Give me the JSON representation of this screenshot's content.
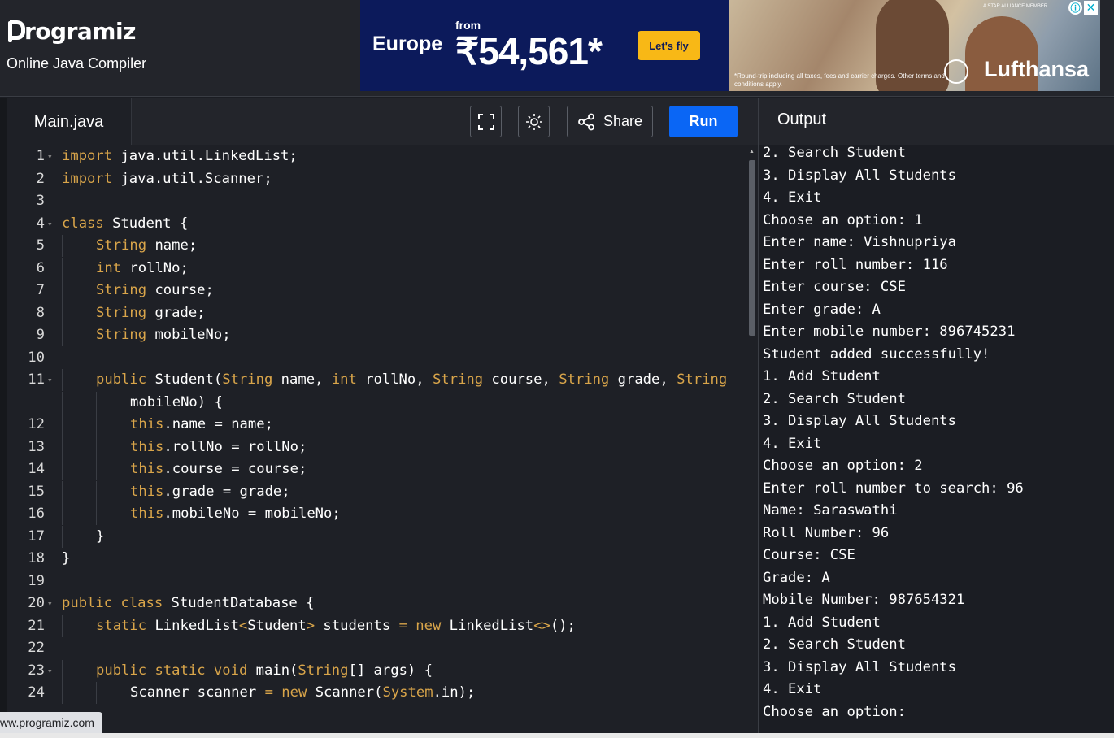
{
  "brand": {
    "name": "rogramiz",
    "subtitle": "Online Java Compiler"
  },
  "ads": {
    "flight": {
      "destination": "Europe",
      "from_label": "from",
      "price": "₹54,561*",
      "cta": "Let's fly"
    },
    "lufthansa": {
      "brand": "Lufthansa",
      "tagline": "A STAR ALLIANCE MEMBER",
      "fine_print": "*Round-trip including all taxes, fees and carrier charges. Other terms and conditions apply.",
      "info_icon": "ⓘ",
      "close_icon": "✕"
    }
  },
  "editor": {
    "tab": "Main.java",
    "buttons": {
      "fullscreen": "fullscreen-icon",
      "theme": "sun-icon",
      "share": "Share",
      "run": "Run"
    },
    "lines": [
      {
        "n": "1",
        "fold": true,
        "segments": [
          [
            "kw",
            "import"
          ],
          [
            "t",
            " java.util.LinkedList;"
          ]
        ]
      },
      {
        "n": "2",
        "fold": false,
        "segments": [
          [
            "kw",
            "import"
          ],
          [
            "t",
            " java.util.Scanner;"
          ]
        ]
      },
      {
        "n": "3",
        "fold": false,
        "segments": []
      },
      {
        "n": "4",
        "fold": true,
        "segments": [
          [
            "kw",
            "class"
          ],
          [
            "t",
            " Student {"
          ]
        ]
      },
      {
        "n": "5",
        "fold": false,
        "indent": 1,
        "segments": [
          [
            "kw",
            "String"
          ],
          [
            "t",
            " name;"
          ]
        ]
      },
      {
        "n": "6",
        "fold": false,
        "indent": 1,
        "segments": [
          [
            "kw",
            "int"
          ],
          [
            "t",
            " rollNo;"
          ]
        ]
      },
      {
        "n": "7",
        "fold": false,
        "indent": 1,
        "segments": [
          [
            "kw",
            "String"
          ],
          [
            "t",
            " course;"
          ]
        ]
      },
      {
        "n": "8",
        "fold": false,
        "indent": 1,
        "segments": [
          [
            "kw",
            "String"
          ],
          [
            "t",
            " grade;"
          ]
        ]
      },
      {
        "n": "9",
        "fold": false,
        "indent": 1,
        "segments": [
          [
            "kw",
            "String"
          ],
          [
            "t",
            " mobileNo;"
          ]
        ]
      },
      {
        "n": "10",
        "fold": false,
        "segments": []
      },
      {
        "n": "11",
        "fold": true,
        "indent": 1,
        "segments": [
          [
            "kw",
            "public"
          ],
          [
            "t",
            " Student("
          ],
          [
            "kw",
            "String"
          ],
          [
            "t",
            " name, "
          ],
          [
            "kw",
            "int"
          ],
          [
            "t",
            " rollNo, "
          ],
          [
            "kw",
            "String"
          ],
          [
            "t",
            " course, "
          ],
          [
            "kw",
            "String"
          ],
          [
            "t",
            " grade, "
          ],
          [
            "kw",
            "String"
          ]
        ]
      },
      {
        "n": "",
        "fold": false,
        "indent": 2,
        "segments": [
          [
            "t",
            "mobileNo) {"
          ]
        ]
      },
      {
        "n": "12",
        "fold": false,
        "indent": 2,
        "segments": [
          [
            "kw",
            "this"
          ],
          [
            "t",
            ".name = name;"
          ]
        ]
      },
      {
        "n": "13",
        "fold": false,
        "indent": 2,
        "segments": [
          [
            "kw",
            "this"
          ],
          [
            "t",
            ".rollNo = rollNo;"
          ]
        ]
      },
      {
        "n": "14",
        "fold": false,
        "indent": 2,
        "segments": [
          [
            "kw",
            "this"
          ],
          [
            "t",
            ".course = course;"
          ]
        ]
      },
      {
        "n": "15",
        "fold": false,
        "indent": 2,
        "segments": [
          [
            "kw",
            "this"
          ],
          [
            "t",
            ".grade = grade;"
          ]
        ]
      },
      {
        "n": "16",
        "fold": false,
        "indent": 2,
        "segments": [
          [
            "kw",
            "this"
          ],
          [
            "t",
            ".mobileNo = mobileNo;"
          ]
        ]
      },
      {
        "n": "17",
        "fold": false,
        "indent": 1,
        "segments": [
          [
            "t",
            "}"
          ]
        ]
      },
      {
        "n": "18",
        "fold": false,
        "segments": [
          [
            "t",
            "}"
          ]
        ]
      },
      {
        "n": "19",
        "fold": false,
        "segments": []
      },
      {
        "n": "20",
        "fold": true,
        "segments": [
          [
            "kw",
            "public"
          ],
          [
            "t",
            " "
          ],
          [
            "kw",
            "class"
          ],
          [
            "t",
            " StudentDatabase {"
          ]
        ]
      },
      {
        "n": "21",
        "fold": false,
        "indent": 1,
        "segments": [
          [
            "kw",
            "static"
          ],
          [
            "t",
            " LinkedList"
          ],
          [
            "kw",
            "<"
          ],
          [
            "t",
            "Student"
          ],
          [
            "kw",
            ">"
          ],
          [
            "t",
            " students "
          ],
          [
            "kw",
            "="
          ],
          [
            "t",
            " "
          ],
          [
            "kw",
            "new"
          ],
          [
            "t",
            " LinkedList"
          ],
          [
            "kw",
            "<>"
          ],
          [
            "t",
            "();"
          ]
        ]
      },
      {
        "n": "22",
        "fold": false,
        "segments": []
      },
      {
        "n": "23",
        "fold": true,
        "indent": 1,
        "segments": [
          [
            "kw",
            "public"
          ],
          [
            "t",
            " "
          ],
          [
            "kw",
            "static"
          ],
          [
            "t",
            " "
          ],
          [
            "kw",
            "void"
          ],
          [
            "t",
            " main("
          ],
          [
            "kw",
            "String"
          ],
          [
            "t",
            "[] args) {"
          ]
        ]
      },
      {
        "n": "24",
        "fold": false,
        "indent": 2,
        "segments": [
          [
            "t",
            "Scanner scanner "
          ],
          [
            "kw",
            "="
          ],
          [
            "t",
            " "
          ],
          [
            "kw",
            "new"
          ],
          [
            "t",
            " Scanner("
          ],
          [
            "kw",
            "System"
          ],
          [
            "t",
            ".in);"
          ]
        ]
      }
    ]
  },
  "output": {
    "title": "Output",
    "lines": [
      "2. Search Student",
      "3. Display All Students",
      "4. Exit",
      "Choose an option: 1",
      "Enter name: Vishnupriya",
      "Enter roll number: 116",
      "Enter course: CSE",
      "Enter grade: A",
      "Enter mobile number: 896745231",
      "Student added successfully!",
      "1. Add Student",
      "2. Search Student",
      "3. Display All Students",
      "4. Exit",
      "Choose an option: 2",
      "Enter roll number to search: 96",
      "Name: Saraswathi",
      "Roll Number: 96",
      "Course: CSE",
      "Grade: A",
      "Mobile Number: 987654321",
      "1. Add Student",
      "2. Search Student",
      "3. Display All Students",
      "4. Exit",
      "Choose an option:"
    ]
  },
  "status_bar": {
    "url": "ww.programiz.com"
  },
  "colors": {
    "accent": "#0a66f5",
    "keyword": "#d9a54a",
    "background": "#1e2026"
  }
}
